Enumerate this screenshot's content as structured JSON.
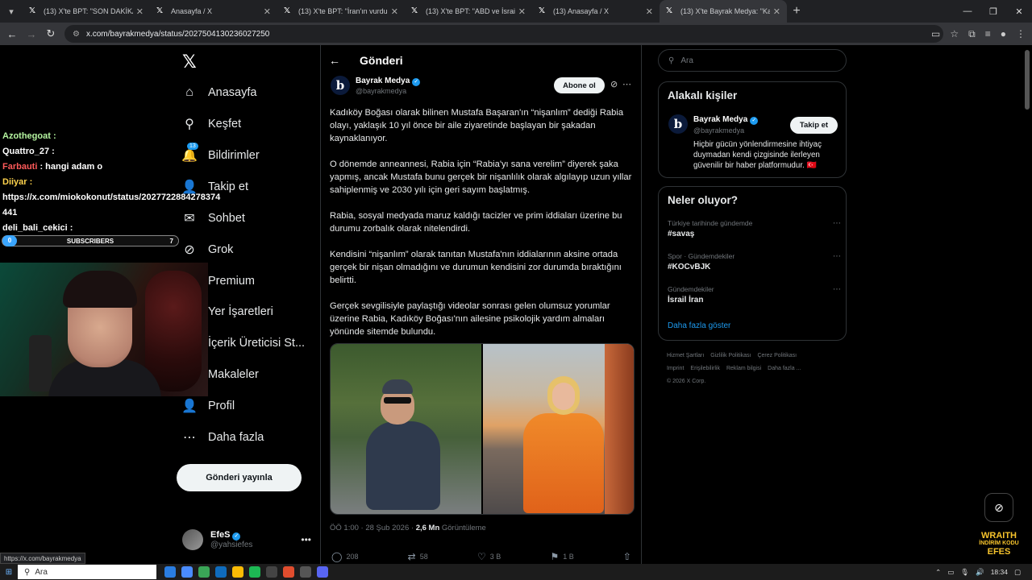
{
  "browser": {
    "tabs": [
      {
        "title": "(13) X'te BPT: \"SON DAKİKA | Tü",
        "active": false
      },
      {
        "title": "Anasayfa / X",
        "active": false
      },
      {
        "title": "(13) X'te BPT: \"İran'ın vurduğu İ",
        "active": false
      },
      {
        "title": "(13) X'te BPT: \"ABD ve İsrail'in İr",
        "active": false
      },
      {
        "title": "(13) Anasayfa / X",
        "active": false
      },
      {
        "title": "(13) X'te Bayrak Medya: \"Kadıkö",
        "active": true
      }
    ],
    "new_tab": "+",
    "url": "x.com/bayrakmedya/status/2027504130236027250",
    "status_url": "https://x.com/bayrakmedya"
  },
  "stream_overlay": {
    "chat": [
      {
        "name": "Azothegoat :",
        "text": "",
        "style": "nm1"
      },
      {
        "name": "Quattro_27 :",
        "text": "",
        "style": "nm2"
      },
      {
        "name": "Farbauti",
        "text": " : hangi adam o",
        "style": "nm3"
      },
      {
        "name": "Diiyar :",
        "text": "",
        "style": "nm4"
      },
      {
        "name": "https://x.com/miokokonut/status/2027722884278374",
        "text": "",
        "style": "nm2"
      },
      {
        "name": "441",
        "text": "",
        "style": "nm2"
      },
      {
        "name": "deli_bali_cekici :",
        "text": "",
        "style": "nm2"
      }
    ],
    "subscribers_label": "SUBSCRIBERS",
    "subscribers_start": "0",
    "subscribers_goal": "7",
    "brand_line1": "WRAITH",
    "brand_line2": "İNDİRİM KODU",
    "brand_line3": "EFES"
  },
  "nav": {
    "items": [
      {
        "label": "Anasayfa",
        "icon": "home-icon",
        "glyph": "⌂"
      },
      {
        "label": "Keşfet",
        "icon": "search-icon",
        "glyph": "⚲"
      },
      {
        "label": "Bildirimler",
        "icon": "bell-icon",
        "glyph": "🔔",
        "badge": "13"
      },
      {
        "label": "Takip et",
        "icon": "add-person-icon",
        "glyph": "👤"
      },
      {
        "label": "Sohbet",
        "icon": "mail-icon",
        "glyph": "✉"
      },
      {
        "label": "Grok",
        "icon": "grok-icon",
        "glyph": "⊘"
      },
      {
        "label": "Premium",
        "icon": "x-premium-icon",
        "glyph": "✕"
      },
      {
        "label": "Yer İşaretleri",
        "icon": "bookmark-icon",
        "glyph": "🔖"
      },
      {
        "label": "İçerik Üreticisi St...",
        "icon": "creator-studio-icon",
        "glyph": "▤"
      },
      {
        "label": "Makaleler",
        "icon": "articles-icon",
        "glyph": "▦"
      },
      {
        "label": "Profil",
        "icon": "profile-icon",
        "glyph": "👤"
      },
      {
        "label": "Daha fazla",
        "icon": "more-circle-icon",
        "glyph": "⋯"
      }
    ],
    "post_button": "Gönderi yayınla",
    "me": {
      "name": "EfeS",
      "handle": "@yahsiefes"
    }
  },
  "post": {
    "header": "Gönderi",
    "author_name": "Bayrak Medya",
    "author_handle": "@bayrakmedya",
    "subscribe": "Abone ol",
    "paragraphs": [
      "Kadıköy Boğası olarak bilinen Mustafa Başaran'ın “nişanlım” dediği Rabia olayı, yaklaşık 10 yıl önce bir aile ziyaretinde başlayan bir şakadan kaynaklanıyor.",
      "O dönemde anneannesi, Rabia için “Rabia'yı sana verelim” diyerek şaka yapmış, ancak Mustafa bunu gerçek bir nişanlılık olarak algılayıp uzun yıllar sahiplenmiş ve 2030 yılı için geri sayım başlatmış.",
      "Rabia, sosyal medyada maruz kaldığı tacizler ve prim iddiaları üzerine bu durumu zorbalık olarak nitelendirdi.",
      "Kendisini “nişanlım” olarak tanıtan Mustafa'nın iddialarının aksine ortada gerçek bir nişan olmadığını ve durumun kendisini zor durumda bıraktığını belirtti.",
      "Gerçek sevgilisiyle paylaştığı videolar sonrası gelen olumsuz yorumlar üzerine Rabia, Kadıköy Boğası'nın ailesine psikolojik yardım almaları yönünde sitemde bulundu."
    ],
    "time": "ÖÖ 1:00 · 28 Şub 2026 · ",
    "views_value": "2,6 Mn",
    "views_label": " Görüntüleme",
    "replies": "208",
    "reposts": "58",
    "likes": "3 B",
    "bookmarks": "1 B"
  },
  "sidebar": {
    "search_placeholder": "Ara",
    "related_title": "Alakalı kişiler",
    "related": {
      "name": "Bayrak Medya",
      "handle": "@bayrakmedya",
      "follow": "Takip et",
      "bio": "Hiçbir gücün yönlendirmesine ihtiyaç duymadan kendi çizgisinde ilerleyen güvenilir bir haber platformudur. 🇹🇷"
    },
    "trends_title": "Neler oluyor?",
    "trends": [
      {
        "context": "Türkiye tarihinde gündemde",
        "topic": "#savaş"
      },
      {
        "context": "Spor · Gündemdekiler",
        "topic": "#KOCvBJK"
      },
      {
        "context": "Gündemdekiler",
        "topic": "İsrail İran"
      }
    ],
    "show_more": "Daha fazla göster",
    "footer": [
      "Hizmet Şartları",
      "Gizlilik Politikası",
      "Çerez Politikası",
      "Imprint",
      "Erişilebilirlik",
      "Reklam bilgisi",
      "Daha fazla ...",
      "© 2026 X Corp."
    ]
  },
  "taskbar": {
    "search": "Ara",
    "time": "18:34"
  }
}
